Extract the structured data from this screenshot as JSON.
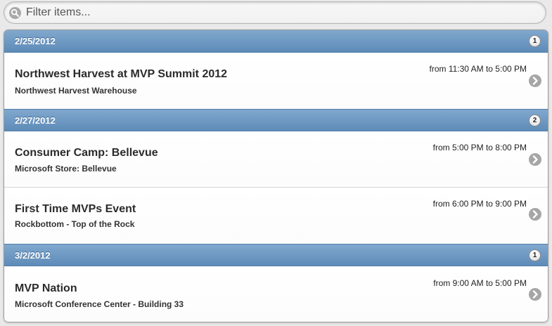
{
  "search": {
    "placeholder": "Filter items..."
  },
  "groups": [
    {
      "date": "2/25/2012",
      "count": "1",
      "items": [
        {
          "title": "Northwest Harvest at MVP Summit 2012",
          "location": "Northwest Harvest Warehouse",
          "time": "from 11:30 AM to 5:00 PM"
        }
      ]
    },
    {
      "date": "2/27/2012",
      "count": "2",
      "items": [
        {
          "title": "Consumer Camp: Bellevue",
          "location": "Microsoft Store: Bellevue",
          "time": "from 5:00 PM to 8:00 PM"
        },
        {
          "title": "First Time MVPs Event",
          "location": "Rockbottom - Top of the Rock",
          "time": "from 6:00 PM to 9:00 PM"
        }
      ]
    },
    {
      "date": "3/2/2012",
      "count": "1",
      "items": [
        {
          "title": "MVP Nation",
          "location": "Microsoft Conference Center - Building 33",
          "time": "from 9:00 AM to 5:00 PM"
        }
      ]
    }
  ],
  "colors": {
    "divider": "#6f98c3",
    "arrow": "#a6a6a6"
  },
  "icons": {
    "search": "search-icon",
    "arrow": "chevron-right-icon"
  }
}
